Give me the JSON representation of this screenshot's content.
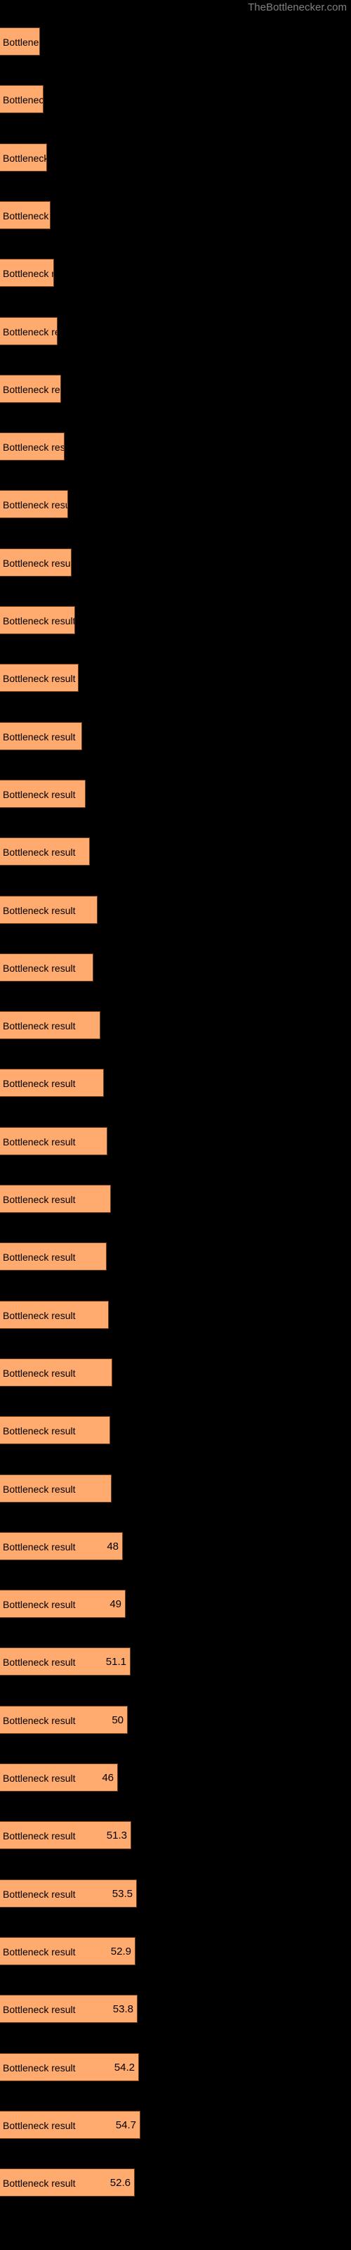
{
  "watermark": {
    "text": "TheBottlenecker.com"
  },
  "colors": {
    "background": "#000000",
    "bar_fill": "#ffaa6e",
    "bar_edge": "#6b3a14",
    "label_text": "#000000",
    "watermark_text": "#808080"
  },
  "chart_data": {
    "type": "bar",
    "orientation": "horizontal",
    "title": "",
    "xlabel": "",
    "ylabel": "",
    "grid": false,
    "legend": null,
    "xlim": [
      0,
      100
    ],
    "bar_label_text": "Bottleneck result",
    "categories": [
      "",
      "",
      "",
      "",
      "",
      "",
      "",
      "",
      "",
      "",
      "",
      "",
      "",
      "",
      "",
      "",
      "",
      "",
      "",
      "",
      "",
      "",
      "",
      "",
      "",
      "",
      "",
      "",
      "",
      "",
      "",
      "",
      "",
      "",
      "",
      "",
      "",
      ""
    ],
    "values": [
      23.4,
      24.2,
      25.0,
      25.8,
      26.6,
      27.4,
      28.2,
      29.0,
      29.8,
      30.8,
      31.6,
      32.4,
      33.2,
      34.0,
      35.2,
      38.2,
      36.8,
      39.2,
      40.6,
      42.0,
      43.2,
      41.6,
      42.4,
      43.8,
      42.8,
      43.5,
      48.0,
      49.0,
      51.1,
      50.0,
      46.0,
      51.3,
      53.5,
      52.9,
      53.8,
      54.2,
      54.7,
      52.6
    ],
    "value_labels": [
      "",
      "",
      "",
      "",
      "",
      "",
      "",
      "",
      "",
      "",
      "",
      "",
      "",
      "",
      "",
      "",
      "",
      "",
      "",
      "",
      "",
      "",
      "",
      "",
      "",
      "",
      "48",
      "49",
      "51.1",
      "50",
      "46",
      "51.3",
      "53.5",
      "52.9",
      "53.8",
      "54.2",
      "54.7",
      "52.6"
    ],
    "bar_pixel_widths": [
      57,
      62,
      67,
      72,
      77,
      82,
      87,
      92,
      97,
      102,
      107,
      112,
      117,
      122,
      128,
      139,
      133,
      143,
      148,
      153,
      158,
      152,
      155,
      160,
      157,
      159,
      175,
      179,
      186,
      182,
      168,
      187,
      195,
      193,
      196,
      198,
      200,
      192
    ]
  }
}
